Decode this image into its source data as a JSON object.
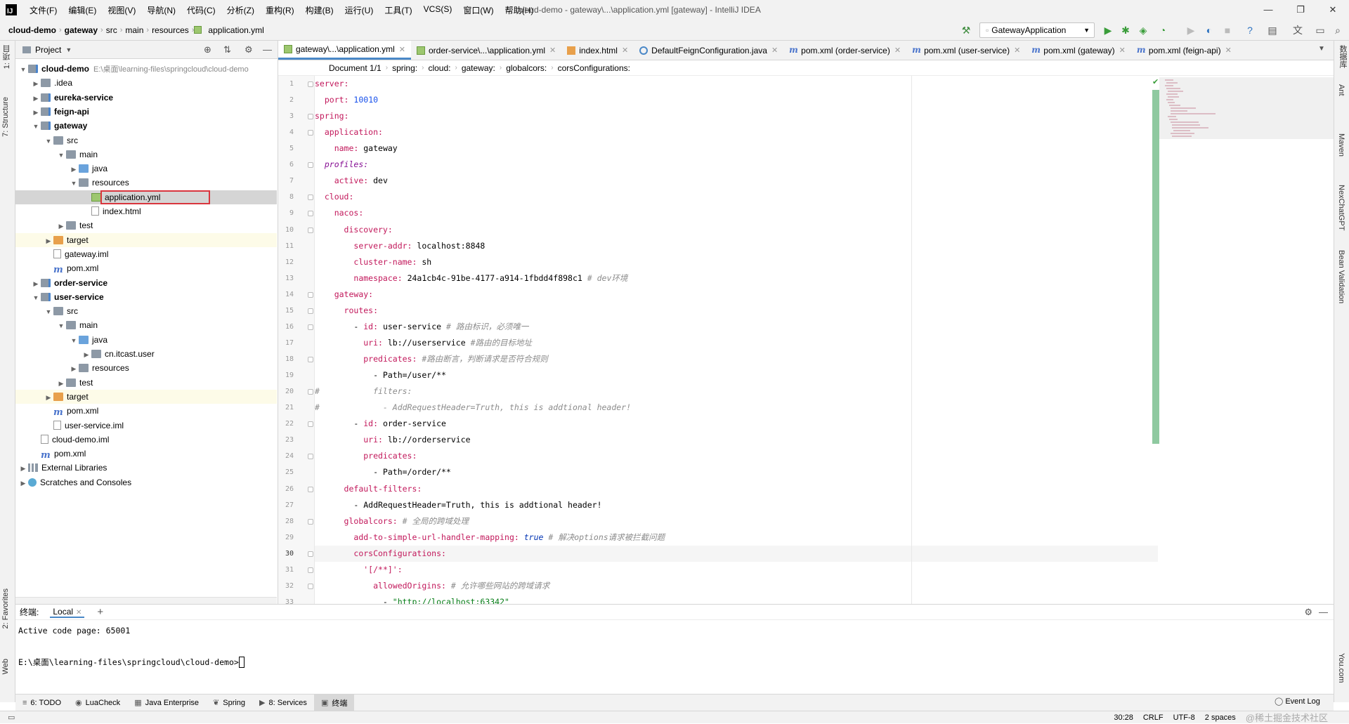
{
  "menubar": {
    "items": [
      "文件(F)",
      "编辑(E)",
      "视图(V)",
      "导航(N)",
      "代码(C)",
      "分析(Z)",
      "重构(R)",
      "构建(B)",
      "运行(U)",
      "工具(T)",
      "VCS(S)",
      "窗口(W)",
      "帮助(H)"
    ],
    "window_title": "cloud-demo - gateway\\...\\application.yml [gateway] - IntelliJ IDEA"
  },
  "navbar": {
    "crumbs": [
      "cloud-demo",
      "gateway",
      "src",
      "main",
      "resources",
      "application.yml"
    ],
    "run_config": "GatewayApplication"
  },
  "left_strip": {
    "tabs": [
      "1: 项目",
      "7: Structure",
      "2: Favorites",
      "Web"
    ]
  },
  "right_strip": {
    "tabs": [
      "数据库",
      "Ant",
      "Maven",
      "NexChatGPT",
      "Bean Validation",
      "You.com"
    ]
  },
  "project": {
    "title": "Project",
    "tree": [
      {
        "label": "cloud-demo",
        "hint": "E:\\桌面\\learning-files\\springcloud\\cloud-demo",
        "depth": 0,
        "icon": "module",
        "bold": true,
        "open": true
      },
      {
        "label": ".idea",
        "depth": 1,
        "icon": "folder",
        "open": false
      },
      {
        "label": "eureka-service",
        "depth": 1,
        "icon": "module",
        "bold": true,
        "open": false
      },
      {
        "label": "feign-api",
        "depth": 1,
        "icon": "module",
        "bold": true,
        "open": false
      },
      {
        "label": "gateway",
        "depth": 1,
        "icon": "module",
        "bold": true,
        "open": true
      },
      {
        "label": "src",
        "depth": 2,
        "icon": "folder",
        "open": true
      },
      {
        "label": "main",
        "depth": 3,
        "icon": "folder",
        "open": true
      },
      {
        "label": "java",
        "depth": 4,
        "icon": "folder-blue",
        "open": false
      },
      {
        "label": "resources",
        "depth": 4,
        "icon": "folder",
        "open": true
      },
      {
        "label": "application.yml",
        "depth": 5,
        "icon": "yml",
        "selected": true,
        "highlighted": true
      },
      {
        "label": "index.html",
        "depth": 5,
        "icon": "file"
      },
      {
        "label": "test",
        "depth": 3,
        "icon": "folder",
        "open": false
      },
      {
        "label": "target",
        "depth": 2,
        "icon": "folder-orange",
        "open": false,
        "yellow": true
      },
      {
        "label": "gateway.iml",
        "depth": 2,
        "icon": "file"
      },
      {
        "label": "pom.xml",
        "depth": 2,
        "icon": "maven"
      },
      {
        "label": "order-service",
        "depth": 1,
        "icon": "module",
        "bold": true,
        "open": false
      },
      {
        "label": "user-service",
        "depth": 1,
        "icon": "module",
        "bold": true,
        "open": true
      },
      {
        "label": "src",
        "depth": 2,
        "icon": "folder",
        "open": true
      },
      {
        "label": "main",
        "depth": 3,
        "icon": "folder",
        "open": true
      },
      {
        "label": "java",
        "depth": 4,
        "icon": "folder-blue",
        "open": true
      },
      {
        "label": "cn.itcast.user",
        "depth": 5,
        "icon": "folder",
        "open": false
      },
      {
        "label": "resources",
        "depth": 4,
        "icon": "folder",
        "open": false
      },
      {
        "label": "test",
        "depth": 3,
        "icon": "folder",
        "open": false
      },
      {
        "label": "target",
        "depth": 2,
        "icon": "folder-orange",
        "open": false,
        "yellow": true
      },
      {
        "label": "pom.xml",
        "depth": 2,
        "icon": "maven"
      },
      {
        "label": "user-service.iml",
        "depth": 2,
        "icon": "file"
      },
      {
        "label": "cloud-demo.iml",
        "depth": 1,
        "icon": "file"
      },
      {
        "label": "pom.xml",
        "depth": 1,
        "icon": "maven"
      },
      {
        "label": "External Libraries",
        "depth": 0,
        "icon": "lib",
        "open": false
      },
      {
        "label": "Scratches and Consoles",
        "depth": 0,
        "icon": "scratch",
        "open": false
      }
    ]
  },
  "editor_tabs": [
    {
      "label": "gateway\\...\\application.yml",
      "icon": "yml",
      "active": true
    },
    {
      "label": "order-service\\...\\application.yml",
      "icon": "yml"
    },
    {
      "label": "index.html",
      "icon": "html"
    },
    {
      "label": "DefaultFeignConfiguration.java",
      "icon": "java"
    },
    {
      "label": "pom.xml (order-service)",
      "icon": "maven"
    },
    {
      "label": "pom.xml (user-service)",
      "icon": "maven"
    },
    {
      "label": "pom.xml (gateway)",
      "icon": "maven"
    },
    {
      "label": "pom.xml (feign-api)",
      "icon": "maven"
    }
  ],
  "editor_breadcrumb": [
    "Document 1/1",
    "spring:",
    "cloud:",
    "gateway:",
    "globalcors:",
    "corsConfigurations:"
  ],
  "code": {
    "current_line": 30,
    "lines": [
      {
        "n": 1,
        "parts": [
          [
            "k",
            "server:"
          ]
        ]
      },
      {
        "n": 2,
        "parts": [
          [
            "v",
            "  "
          ],
          [
            "k",
            "port:"
          ],
          [
            "v",
            " "
          ],
          [
            "n",
            "10010"
          ]
        ]
      },
      {
        "n": 3,
        "parts": [
          [
            "k",
            "spring:"
          ]
        ]
      },
      {
        "n": 4,
        "parts": [
          [
            "v",
            "  "
          ],
          [
            "k",
            "application:"
          ]
        ]
      },
      {
        "n": 5,
        "parts": [
          [
            "v",
            "    "
          ],
          [
            "k",
            "name:"
          ],
          [
            "v",
            " gateway"
          ]
        ]
      },
      {
        "n": 6,
        "parts": [
          [
            "v",
            "  "
          ],
          [
            "pf",
            "profiles:"
          ]
        ]
      },
      {
        "n": 7,
        "parts": [
          [
            "v",
            "    "
          ],
          [
            "k",
            "active:"
          ],
          [
            "v",
            " dev"
          ]
        ]
      },
      {
        "n": 8,
        "parts": [
          [
            "v",
            "  "
          ],
          [
            "k",
            "cloud:"
          ]
        ]
      },
      {
        "n": 9,
        "parts": [
          [
            "v",
            "    "
          ],
          [
            "k",
            "nacos:"
          ]
        ]
      },
      {
        "n": 10,
        "parts": [
          [
            "v",
            "      "
          ],
          [
            "k",
            "discovery:"
          ]
        ]
      },
      {
        "n": 11,
        "parts": [
          [
            "v",
            "        "
          ],
          [
            "k",
            "server-addr:"
          ],
          [
            "v",
            " localhost:8848"
          ]
        ]
      },
      {
        "n": 12,
        "parts": [
          [
            "v",
            "        "
          ],
          [
            "k",
            "cluster-name:"
          ],
          [
            "v",
            " sh"
          ]
        ]
      },
      {
        "n": 13,
        "parts": [
          [
            "v",
            "        "
          ],
          [
            "k",
            "namespace:"
          ],
          [
            "v",
            " 24a1cb4c-91be-4177-a914-1fbdd4f898c1 "
          ],
          [
            "cm",
            "# dev环境"
          ]
        ]
      },
      {
        "n": 14,
        "parts": [
          [
            "v",
            "    "
          ],
          [
            "k",
            "gateway:"
          ]
        ]
      },
      {
        "n": 15,
        "parts": [
          [
            "v",
            "      "
          ],
          [
            "k",
            "routes:"
          ]
        ]
      },
      {
        "n": 16,
        "parts": [
          [
            "v",
            "        - "
          ],
          [
            "k",
            "id:"
          ],
          [
            "v",
            " user-service "
          ],
          [
            "cm",
            "# 路由标识，必须唯一"
          ]
        ]
      },
      {
        "n": 17,
        "parts": [
          [
            "v",
            "          "
          ],
          [
            "k",
            "uri:"
          ],
          [
            "v",
            " lb://userservice "
          ],
          [
            "cm",
            "#路由的目标地址"
          ]
        ]
      },
      {
        "n": 18,
        "parts": [
          [
            "v",
            "          "
          ],
          [
            "k",
            "predicates:"
          ],
          [
            "v",
            " "
          ],
          [
            "cm",
            "#路由断言，判断请求是否符合规则"
          ]
        ]
      },
      {
        "n": 19,
        "parts": [
          [
            "v",
            "            - Path=/user/**"
          ]
        ]
      },
      {
        "n": 20,
        "parts": [
          [
            "cm",
            "#           filters:"
          ]
        ]
      },
      {
        "n": 21,
        "parts": [
          [
            "cm",
            "#             - AddRequestHeader=Truth, this is addtional header!"
          ]
        ]
      },
      {
        "n": 22,
        "parts": [
          [
            "v",
            "        - "
          ],
          [
            "k",
            "id:"
          ],
          [
            "v",
            " order-service"
          ]
        ]
      },
      {
        "n": 23,
        "parts": [
          [
            "v",
            "          "
          ],
          [
            "k",
            "uri:"
          ],
          [
            "v",
            " lb://orderservice"
          ]
        ]
      },
      {
        "n": 24,
        "parts": [
          [
            "v",
            "          "
          ],
          [
            "k",
            "predicates:"
          ]
        ]
      },
      {
        "n": 25,
        "parts": [
          [
            "v",
            "            - Path=/order/**"
          ]
        ]
      },
      {
        "n": 26,
        "parts": [
          [
            "v",
            "      "
          ],
          [
            "k",
            "default-filters:"
          ]
        ]
      },
      {
        "n": 27,
        "parts": [
          [
            "v",
            "        - AddRequestHeader=Truth, this is addtional header!"
          ]
        ]
      },
      {
        "n": 28,
        "parts": [
          [
            "v",
            "      "
          ],
          [
            "k",
            "globalcors:"
          ],
          [
            "v",
            " "
          ],
          [
            "cm",
            "# 全局的跨域处理"
          ]
        ]
      },
      {
        "n": 29,
        "parts": [
          [
            "v",
            "        "
          ],
          [
            "k",
            "add-to-simple-url-handler-mapping:"
          ],
          [
            "v",
            " "
          ],
          [
            "kw",
            "true"
          ],
          [
            "v",
            " "
          ],
          [
            "cm",
            "# 解决options请求被拦截问题"
          ]
        ]
      },
      {
        "n": 30,
        "parts": [
          [
            "v",
            "        "
          ],
          [
            "k",
            "corsConfigurations:"
          ]
        ]
      },
      {
        "n": 31,
        "parts": [
          [
            "v",
            "          "
          ],
          [
            "k",
            "'[/**]':"
          ]
        ]
      },
      {
        "n": 32,
        "parts": [
          [
            "v",
            "            "
          ],
          [
            "k",
            "allowedOrigins:"
          ],
          [
            "v",
            " "
          ],
          [
            "cm",
            "# 允许哪些网站的跨域请求"
          ]
        ]
      },
      {
        "n": 33,
        "parts": [
          [
            "v",
            "              - "
          ],
          [
            "s",
            "\"http://localhost:63342\""
          ]
        ]
      }
    ]
  },
  "terminal": {
    "title": "终端:",
    "tab": "Local",
    "lines": [
      "Active code page: 65001",
      "",
      "E:\\桌面\\learning-files\\springcloud\\cloud-demo>"
    ]
  },
  "bottom_tools": [
    {
      "label": "6: TODO",
      "icon": "≡"
    },
    {
      "label": "LuaCheck",
      "icon": "◉"
    },
    {
      "label": "Java Enterprise",
      "icon": "▦"
    },
    {
      "label": "Spring",
      "icon": "❦"
    },
    {
      "label": "8: Services",
      "icon": "▶"
    },
    {
      "label": "终端",
      "icon": "▣",
      "active": true
    }
  ],
  "status": {
    "event_log": "Event Log",
    "position": "30:28",
    "line_sep": "CRLF",
    "encoding": "UTF-8",
    "indent": "2 spaces",
    "watermark": "@稀土掘金技术社区"
  }
}
